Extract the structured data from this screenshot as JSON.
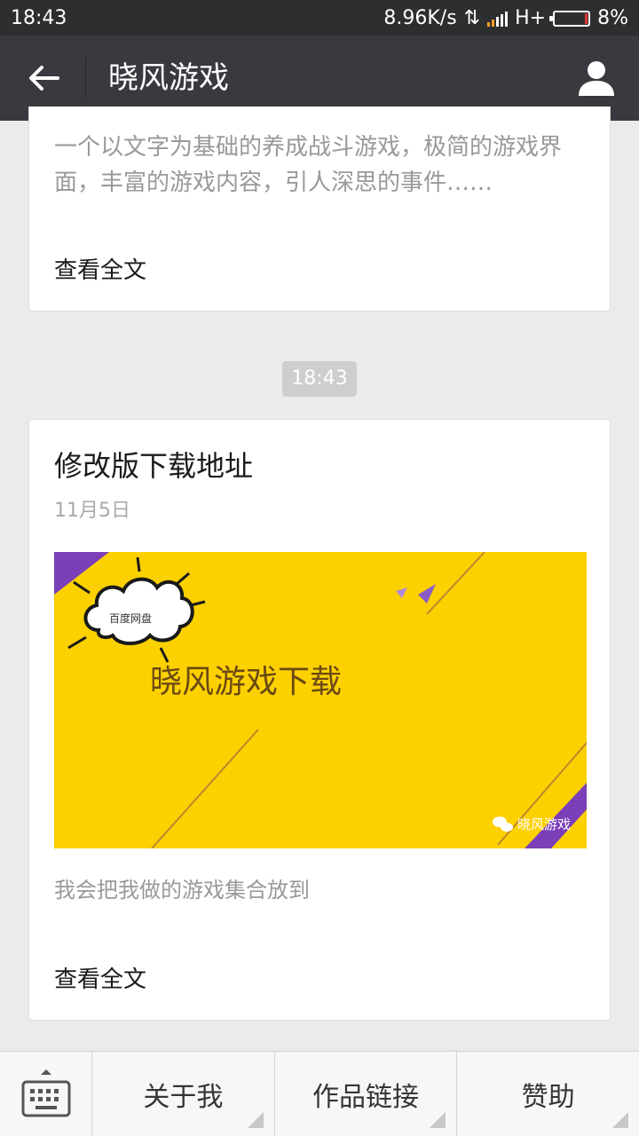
{
  "status_bar": {
    "time": "18:43",
    "net_speed": "8.96K/s",
    "data_arrows": "⇅",
    "network_type": "H+",
    "battery_level": 0.08,
    "battery_text": "8%"
  },
  "header": {
    "title": "晓风游戏"
  },
  "messages": {
    "card1": {
      "description": "一个以文字为基础的养成战斗游戏，极简的游戏界面，丰富的游戏内容，引人深思的事件……",
      "read_more": "查看全文"
    },
    "timestamp": "18:43",
    "card2": {
      "title": "修改版下载地址",
      "date": "11月5日",
      "cover": {
        "cloud_text": "百度网盘",
        "headline": "晓风游戏下载",
        "watermark": "晓风游戏",
        "background_color": "#fdd000",
        "accent_color": "#7b3fb8"
      },
      "description": "我会把我做的游戏集合放到",
      "read_more": "查看全文"
    }
  },
  "bottom_menu": {
    "keyboard_icon": "keyboard-icon",
    "items": [
      {
        "label": "关于我"
      },
      {
        "label": "作品链接"
      },
      {
        "label": "赞助"
      }
    ]
  }
}
